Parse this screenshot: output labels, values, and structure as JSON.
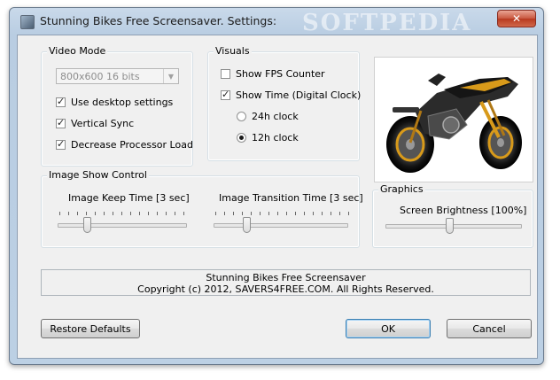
{
  "window": {
    "title": "Stunning Bikes Free Screensaver. Settings:",
    "watermark": "SOFTPEDIA",
    "close_label": "✕"
  },
  "video_mode": {
    "group_title": "Video Mode",
    "resolution_value": "800x600 16 bits",
    "use_desktop_label": "Use desktop settings",
    "use_desktop_checked": true,
    "vsync_label": "Vertical Sync",
    "vsync_checked": true,
    "decrease_load_label": "Decrease Processor Load",
    "decrease_load_checked": true
  },
  "visuals": {
    "group_title": "Visuals",
    "fps_label": "Show FPS Counter",
    "fps_checked": false,
    "time_label": "Show Time (Digital Clock)",
    "time_checked": true,
    "clock_24_label": "24h clock",
    "clock_12_label": "12h clock",
    "clock_selected": "12h"
  },
  "image_show": {
    "group_title": "Image Show Control",
    "keep_time_label": "Image Keep Time [3 sec]",
    "keep_time_value_sec": 3,
    "transition_label": "Image Transition Time [3 sec]",
    "transition_value_sec": 3
  },
  "graphics": {
    "group_title": "Graphics",
    "brightness_label": "Screen Brightness [100%]",
    "brightness_value_pct": 100
  },
  "info": {
    "line1": "Stunning Bikes Free Screensaver",
    "line2": "Copyright (c) 2012, SAVERS4FREE.COM. All Rights Reserved."
  },
  "buttons": {
    "restore_label": "Restore Defaults",
    "ok_label": "OK",
    "cancel_label": "Cancel"
  },
  "colors": {
    "titlebar": "#bcd0e4",
    "client": "#f0f0f0",
    "bike_accent": "#d89a1a"
  }
}
